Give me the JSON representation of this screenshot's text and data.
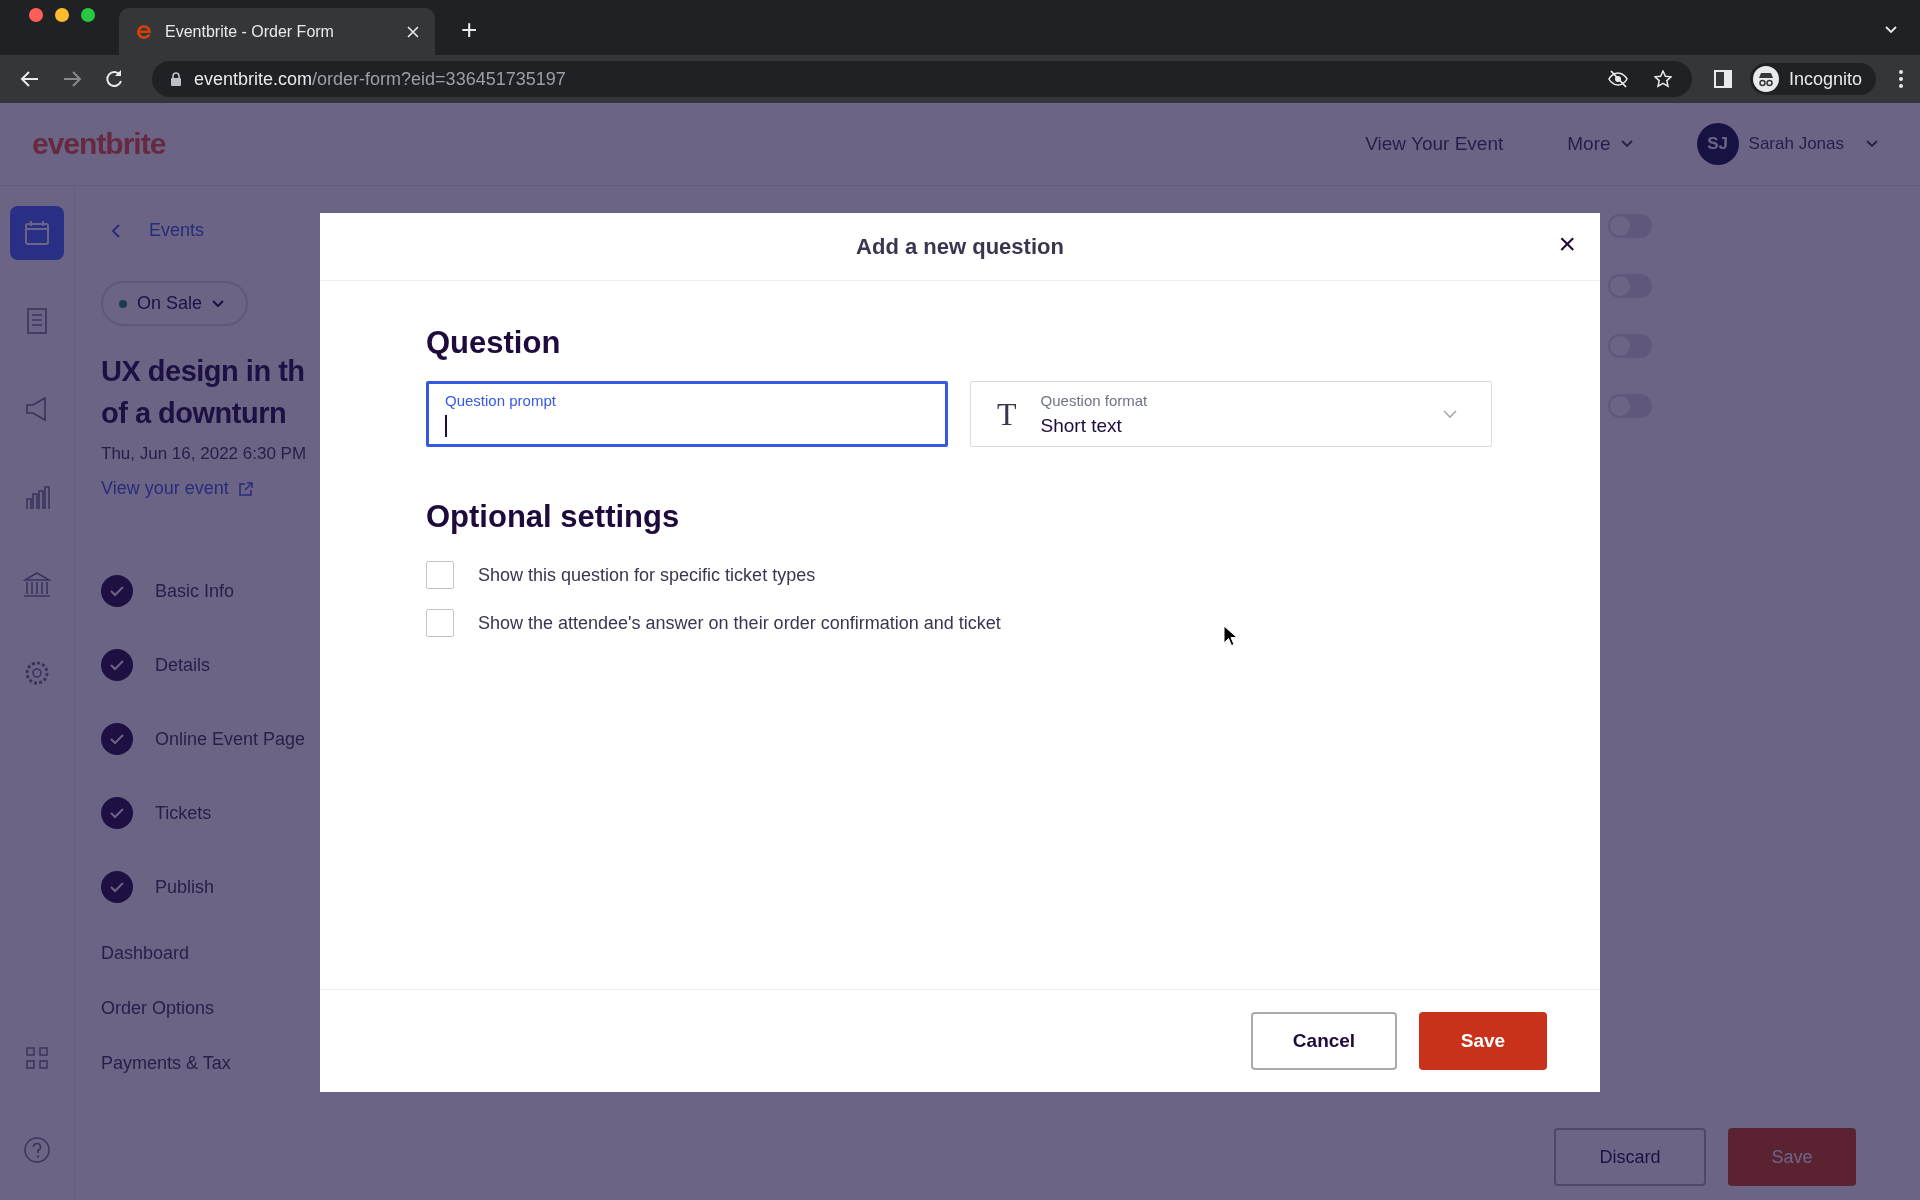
{
  "browser": {
    "tab_title": "Eventbrite - Order Form",
    "new_tab": "+",
    "url_host": "eventbrite.com",
    "url_path": "/order-form?eid=336451735197",
    "profile": "Incognito"
  },
  "header": {
    "logo": "eventbrite",
    "links": [
      "View Your Event",
      "More"
    ],
    "user": {
      "initials": "SJ",
      "name": "Sarah Jonas"
    }
  },
  "rail": [
    {
      "selected": true
    },
    {
      "selected": false
    },
    {
      "selected": false
    },
    {
      "selected": false
    },
    {
      "selected": false
    },
    {
      "selected": false
    }
  ],
  "event": {
    "back": "Events",
    "status": "On Sale",
    "title": "UX design in th",
    "title_line2": "of a downturn",
    "date": "Thu, Jun 16, 2022 6:30 PM",
    "view_link": "View your event"
  },
  "steps": [
    {
      "label": "Basic Info",
      "done": true
    },
    {
      "label": "Details",
      "done": true
    },
    {
      "label": "Online Event Page",
      "done": true
    },
    {
      "label": "Tickets",
      "done": true
    },
    {
      "label": "Publish",
      "done": true
    }
  ],
  "nav": [
    "Dashboard",
    "Order Options",
    "Payments & Tax"
  ],
  "toggles": [
    {
      "on": false
    },
    {
      "on": false
    },
    {
      "on": false
    },
    {
      "on": false
    }
  ],
  "page_buttons": [
    "Discard",
    "Save"
  ],
  "modal": {
    "title": "Add a new question",
    "close": "×",
    "section_title": "Question",
    "prompt_field": {
      "label": "Question prompt",
      "focused": true
    },
    "format_field": {
      "label": "Question format",
      "value": "Short text",
      "icon": "T"
    },
    "optional_title": "Optional settings",
    "options": [
      {
        "label": "Show this question for specific ticket types",
        "checked": false
      },
      {
        "label": "Show the attendee's answer on their order confirmation and ticket",
        "checked": false
      }
    ],
    "buttons": [
      {
        "label": "Cancel",
        "kind": "secondary"
      },
      {
        "label": "Save",
        "kind": "primary"
      }
    ]
  }
}
